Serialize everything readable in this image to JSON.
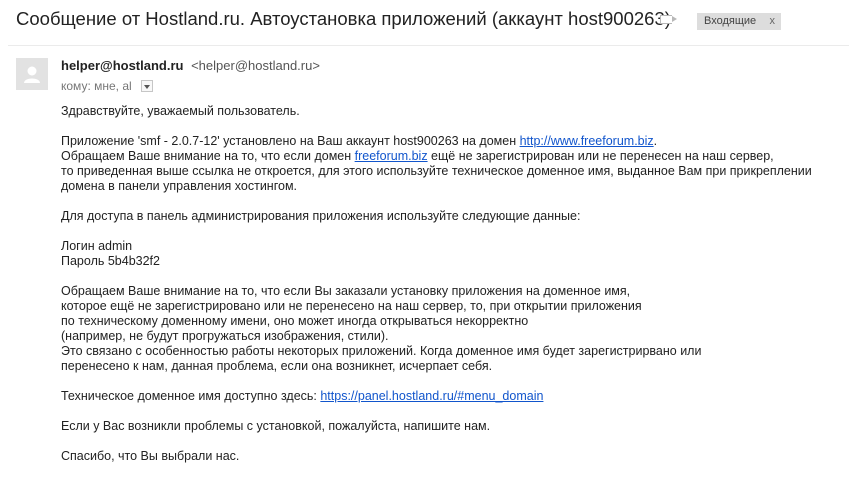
{
  "header": {
    "subject": "Сообщение от Hostland.ru. Автоустановка приложений (аккаунт host900263)",
    "label": "Входящие",
    "label_close": "x"
  },
  "message": {
    "sender_name": "helper@hostland.ru",
    "sender_email": "<helper@hostland.ru>",
    "recipients": "кому: мне, al"
  },
  "body": {
    "greeting": "Здравствуйте, уважаемый пользователь.",
    "p1_l1_a": "Приложение 'smf - 2.0.7-12' установлено на Ваш аккаунт host900263 на домен ",
    "p1_l1_link": "http://www.freeforum.biz",
    "p1_l1_b": ".",
    "p1_l2_a": "Обращаем Ваше внимание на то, что если домен ",
    "p1_l2_link": "freeforum.biz",
    "p1_l2_b": " ещё не зарегистрирован или не перенесен на наш сервер,",
    "p1_l3": "то приведенная выше ссылка не откроется, для этого используйте техническое доменное имя, выданное Вам при прикреплении",
    "p1_l4": "домена в панели управления хостингом.",
    "p2": "Для доступа в панель администрирования приложения используйте следующие данные:",
    "login": "Логин admin",
    "password": "Пароль 5b4b32f2",
    "p3_l1": "Обращаем Ваше внимание на то, что если Вы заказали установку приложения на доменное имя,",
    "p3_l2": "которое ещё не зарегистрировано или не перенесено на наш сервер, то, при открытии приложения",
    "p3_l3": "по техническому доменному имени, оно может иногда открываться некорректно",
    "p3_l4": "(например, не будут прогружаться изображения, стили).",
    "p3_l5": "Это связано с особенностью работы некоторых приложений. Когда доменное имя будет зарегистрирвано или",
    "p3_l6": "перенесено к нам, данная проблема, если она возникнет, исчерпает себя.",
    "p4_a": "Техническое доменное имя доступно здесь: ",
    "p4_link": "https://panel.hostland.ru/#menu_domain",
    "p5": "Если у Вас возникли проблемы с установкой, пожалуйста, напишите нам.",
    "p6": "Спасибо, что Вы выбрали нас."
  },
  "colors": {
    "link": "#1155cc",
    "label_bg": "#dddddd"
  },
  "icons": {
    "avatar": "person-icon",
    "label_marker": "label-icon",
    "details": "chevron-down-icon"
  }
}
